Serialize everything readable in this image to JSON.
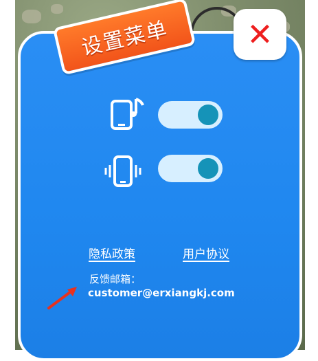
{
  "title": "设置菜单",
  "close_icon": "close-icon",
  "settings": [
    {
      "name": "sound",
      "icon": "music-phone-icon",
      "enabled": true
    },
    {
      "name": "vibration",
      "icon": "vibrate-icon",
      "enabled": true
    }
  ],
  "links": {
    "privacy": "隐私政策",
    "agreement": "用户协议"
  },
  "feedback": {
    "label": "反馈邮箱：",
    "email": "customer@erxiangkj.com"
  },
  "colors": {
    "panel": "#1f87ef",
    "title_badge": "#f2541a",
    "close_x": "#ee1f1f",
    "toggle_track": "#d7efff",
    "toggle_knob": "#1593b8",
    "annotation_arrow": "#e8321e"
  }
}
